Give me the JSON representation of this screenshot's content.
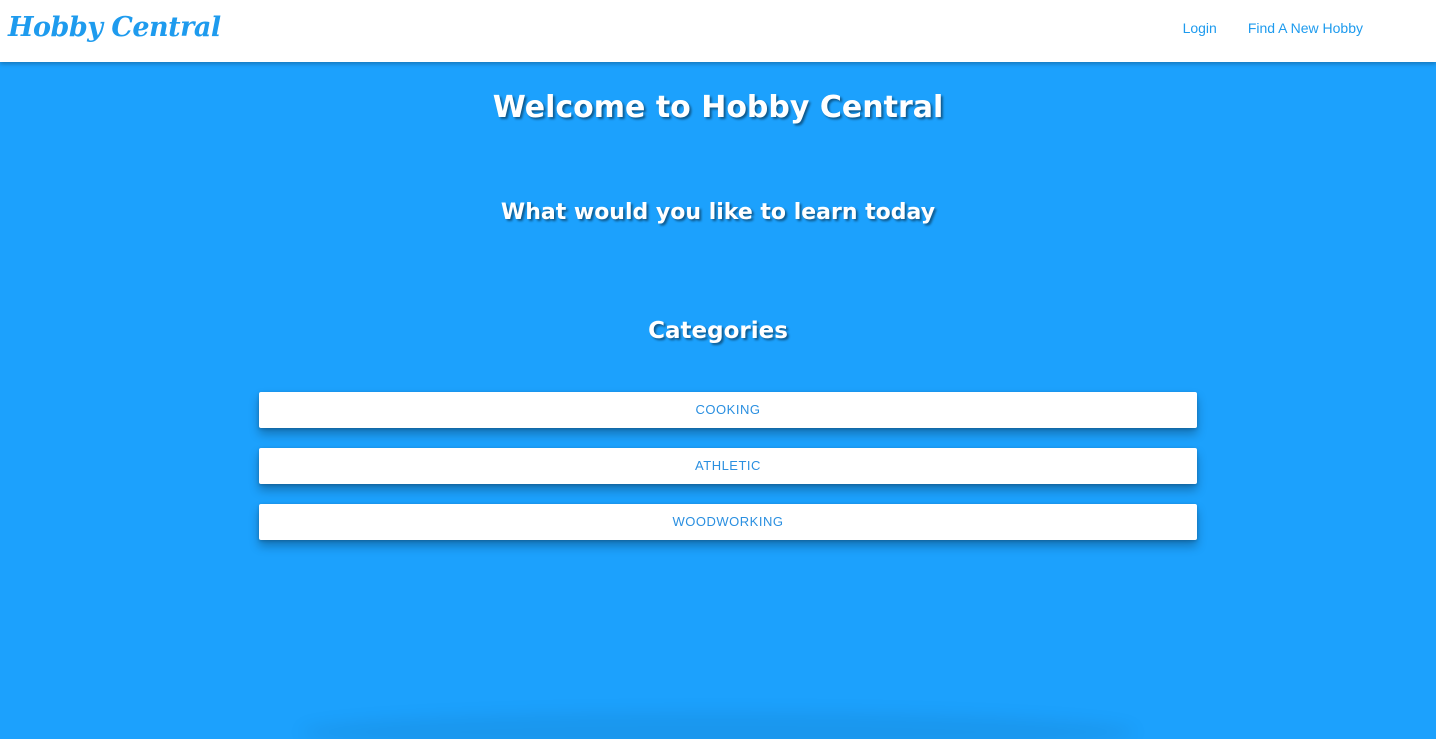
{
  "navbar": {
    "brand": "Hobby Central",
    "links": [
      {
        "label": "Login"
      },
      {
        "label": "Find A New Hobby"
      }
    ]
  },
  "main": {
    "title": "Welcome to Hobby Central",
    "subtitle": "What would you like to learn today",
    "categories_heading": "Categories",
    "categories": [
      {
        "label": "COOKING"
      },
      {
        "label": "ATHLETIC"
      },
      {
        "label": "WOODWORKING"
      }
    ]
  },
  "colors": {
    "background": "#1ca1fd",
    "navbar": "#ffffff",
    "accent": "#1e9bee",
    "heading_text": "#ffffff"
  }
}
